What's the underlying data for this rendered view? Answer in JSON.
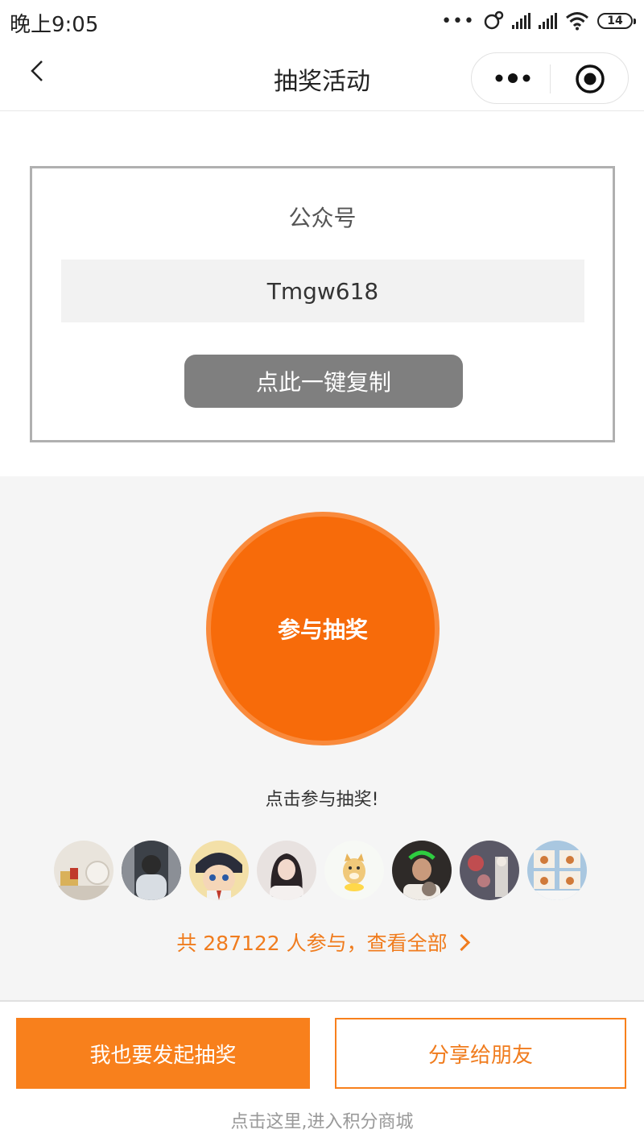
{
  "status_bar": {
    "time": "晚上9:05",
    "battery": "14"
  },
  "nav": {
    "title": "抽奖活动"
  },
  "account_card": {
    "label": "公众号",
    "value": "Tmgw618",
    "copy_button": "点此一键复制"
  },
  "lottery": {
    "join_button": "参与抽奖",
    "hint": "点击参与抽奖!",
    "participants_text": "共 287122 人参与，查看全部",
    "avatars": [
      "avatar-1",
      "avatar-2",
      "avatar-3",
      "avatar-4",
      "avatar-5",
      "avatar-6",
      "avatar-7",
      "avatar-8"
    ]
  },
  "bottom": {
    "start_button": "我也要发起抽奖",
    "share_button": "分享给朋友",
    "points_link": "点击这里,进入积分商城"
  },
  "colors": {
    "accent": "#f8801c",
    "join_circle": "#f76b0a",
    "copy_button": "#7f7f7f",
    "section_bg": "#f5f5f5"
  }
}
